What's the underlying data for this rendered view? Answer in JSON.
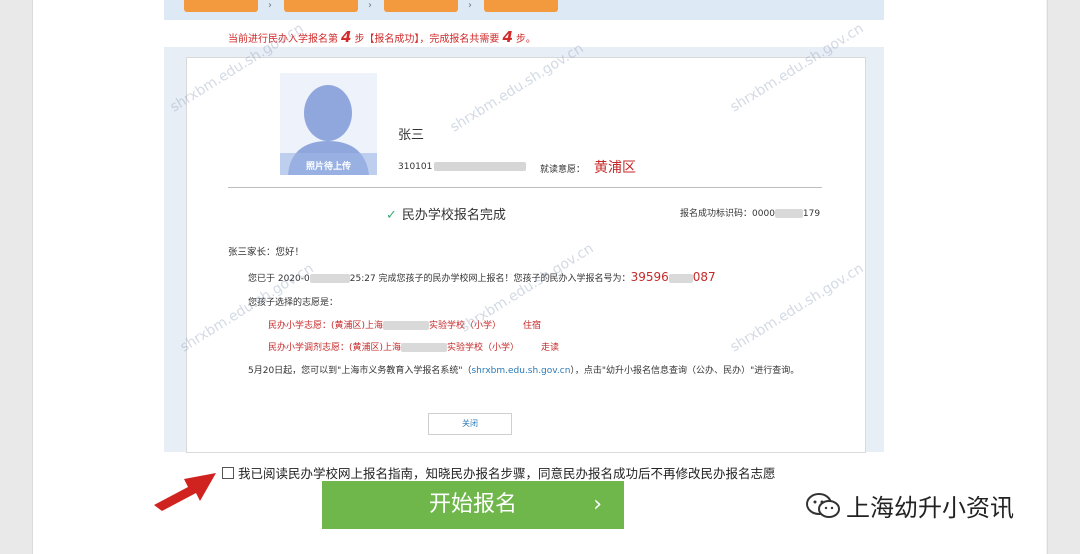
{
  "progress": {
    "prefix": "当前进行民办入学报名第",
    "current_step": "4",
    "middle": "步【报名成功】，完成报名共需要",
    "total_steps": "4",
    "suffix": "步。"
  },
  "watermark": "shrxbm.edu.sh.gov.cn",
  "student": {
    "photo_caption": "照片待上传",
    "name": "张三",
    "id_prefix": "310101",
    "district_label": "就读意愿：",
    "district": "黄浦区"
  },
  "result": {
    "title": "民办学校报名完成",
    "code_label": "报名成功标识码：",
    "code_prefix": "0000",
    "code_suffix": "179"
  },
  "letter": {
    "greeting": "张三家长：您好！",
    "line1_a": "您已于 2020-0",
    "line1_b": "25:27 完成您孩子的民办学校网上报名！您孩子的民办入学报名号为：",
    "reg_prefix": "39596",
    "reg_suffix": "087",
    "line2": "您孩子选择的志愿是：",
    "choice1_a": "民办小学志愿：(黄浦区)上海",
    "choice1_b": "实验学校（小学）",
    "choice1_c": "住宿",
    "choice2_a": "民办小学调剂志愿：(黄浦区)上海",
    "choice2_b": "实验学校（小学）",
    "choice2_c": "走读",
    "line5_a": "5月20日起，您可以到\"上海市义务教育入学报名系统\"（",
    "line5_link": "shrxbm.edu.sh.gov.cn",
    "line5_b": "），点击\"幼升小报名信息查询（公办、民办）\"进行查询。"
  },
  "close_label": "关闭",
  "agreement": "我已阅读民办学校网上报名指南，知晓民办报名步骤，同意民办报名成功后不再修改民办报名志愿",
  "start_label": "开始报名",
  "start_chevron": "›",
  "brand": "上海幼升小资讯",
  "colors": {
    "accent_red": "#c52a2a",
    "button_green": "#6fb64b",
    "step_orange": "#f39a3f"
  }
}
